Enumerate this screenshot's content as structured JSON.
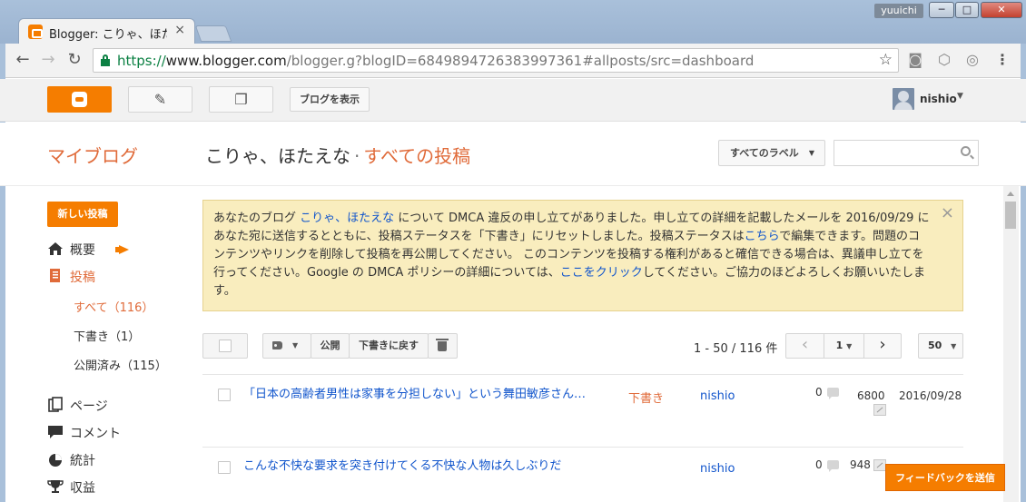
{
  "browser": {
    "tab_title": "Blogger: こりゃ、ほたえな",
    "tab_close": "×",
    "profile_name": "yuuichi",
    "win_min": "─",
    "win_max": "□",
    "win_close": "✕",
    "nav_back": "←",
    "nav_forward": "→",
    "nav_reload": "↻",
    "url_scheme": "https://",
    "url_host": "www.blogger.com",
    "url_path": "/blogger.g?blogID=6849894726383997361#allposts/src=dashboard",
    "bookmark_star": "☆",
    "menu_dots": "⋮"
  },
  "header": {
    "view_blog_label": "ブログを表示",
    "pencil": "✎",
    "pages_glyph": "❐",
    "username": "nishio",
    "caret": "▼"
  },
  "title_row": {
    "my_blog": "マイブログ",
    "blog_name": "こりゃ、ほたえな",
    "separator": "·",
    "section": "すべての投稿",
    "labels_dropdown": "すべてのラベル",
    "caret": "▼",
    "search_placeholder": ""
  },
  "sidebar": {
    "new_post": "新しい投稿",
    "items": [
      {
        "label": "概要",
        "icon": "home-icon"
      },
      {
        "label": "投稿",
        "icon": "posts-icon"
      },
      {
        "label": "ページ",
        "icon": "pages-icon"
      },
      {
        "label": "コメント",
        "icon": "comment-icon"
      },
      {
        "label": "統計",
        "icon": "stats-icon"
      },
      {
        "label": "収益",
        "icon": "earnings-icon"
      }
    ],
    "sub_items": [
      {
        "label": "すべて（116）"
      },
      {
        "label": "下書き（1）"
      },
      {
        "label": "公開済み（115）"
      }
    ]
  },
  "notice": {
    "p1": "あなたのブログ ",
    "blog_link": "こりゃ、ほたえな",
    "p2": " について DMCA 違反の申し立てがありました。申し立ての詳細を記載したメールを 2016/09/29 にあなた宛に送信するとともに、投稿ステータスを「下書き」にリセットしました。投稿ステータスは",
    "here_link": "こちら",
    "p3": "で編集できます。問題のコンテンツやリンクを削除して投稿を再公開してください。 このコンテンツを投稿する権利があると確信できる場合は、異議申し立てを行ってください。Google の DMCA ポリシーの詳細については、",
    "click_link": "ここをクリック",
    "p4": "してください。ご協力のほどよろしくお願いいたします。",
    "close": "×"
  },
  "actions": {
    "caret": "▼",
    "publish": "公開",
    "revert": "下書きに戻す",
    "count": "1 - 50 / 116 件",
    "prev": "‹",
    "page": "1",
    "page_caret": "▼",
    "next": "›",
    "per_page": "50",
    "per_page_caret": "▼"
  },
  "posts": [
    {
      "title": "「日本の高齢者男性は家事を分担しない」という舞田敏彦さん…",
      "status": "下書き",
      "author": "nishio",
      "comments": "0",
      "views": "6800",
      "date": "2016/09/28"
    },
    {
      "title": "こんな不快な要求を突き付けてくる不快な人物は久しぶりだ",
      "status": "",
      "author": "nishio",
      "comments": "0",
      "views": "948",
      "date": ""
    }
  ],
  "feedback": "フィードバックを送信",
  "colors": {
    "accent": "#f57d00",
    "link": "#1155cc",
    "notice_bg": "#f9edbe"
  }
}
